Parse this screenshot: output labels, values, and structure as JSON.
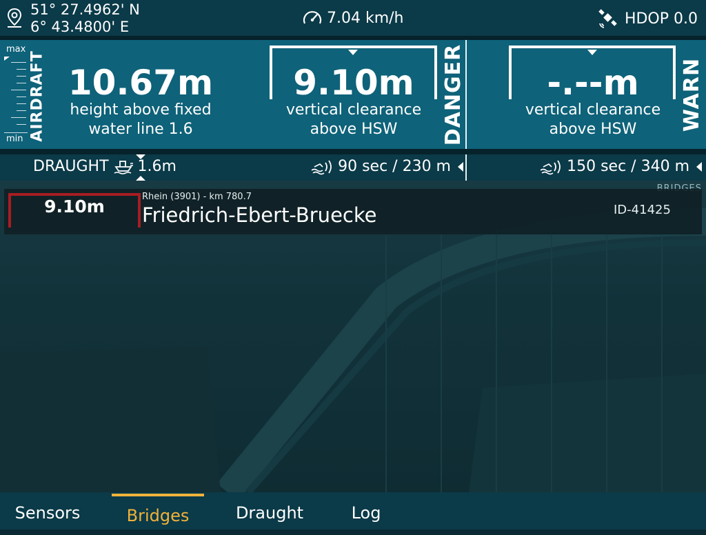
{
  "status": {
    "latitude": "51° 27.4962' N",
    "longitude": "6° 43.4800' E",
    "speed": "7.04 km/h",
    "hdop": "HDOP 0.0"
  },
  "airdraft": {
    "label": "AIRDRAFT",
    "scale_max": "max",
    "scale_min": "min",
    "value": "10.67m",
    "line1": "height above fixed",
    "line2": "water line 1.6"
  },
  "danger": {
    "label": "DANGER",
    "value": "9.10m",
    "line1": "vertical clearance",
    "line2": "above HSW"
  },
  "warn": {
    "label": "WARN",
    "value": "-.--m",
    "line1": "vertical clearance",
    "line2": "above HSW"
  },
  "draught": {
    "label": "DRAUGHT",
    "value": "1.6m"
  },
  "eta": {
    "danger": "90 sec / 230 m",
    "warn": "150 sec / 340 m"
  },
  "bridges": {
    "section_label": "BRIDGES",
    "clearance": "9.10m",
    "river": "Rhein (3901) - km 780.7",
    "name": "Friedrich-Ebert-Bruecke",
    "id": "ID-41425"
  },
  "tabs": [
    "Sensors",
    "Bridges",
    "Draught",
    "Log"
  ],
  "active_tab": "Bridges",
  "colors": {
    "panel": "#0e6279",
    "bar": "#0b3a48",
    "accent": "#f0b23a",
    "danger_bracket": "#a71d23"
  },
  "icons": {
    "location": "location-pin-icon",
    "speed": "speedometer-icon",
    "gps": "satellite-icon",
    "draught": "ship-draught-icon",
    "eta": "wave-signal-icon"
  }
}
